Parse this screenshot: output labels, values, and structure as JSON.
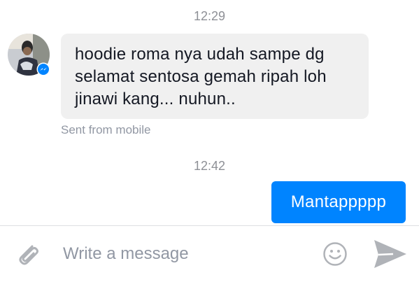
{
  "thread": {
    "timestamps": [
      "12:29",
      "12:42"
    ],
    "incoming": {
      "avatar_icon": "user-avatar-with-messenger-badge",
      "lines": [
        "hoodie roma nya udah sampe dg",
        "selamat sentosa gemah ripah loh",
        "jinawi kang... nuhun.."
      ],
      "footnote": "Sent from mobile",
      "bubble_color": "#f0f0f0"
    },
    "outgoing": {
      "text": "Mantappppp",
      "bubble_color": "#0084ff"
    }
  },
  "composer": {
    "placeholder": "Write a message",
    "value": "",
    "icons": {
      "attach": "paperclip-icon",
      "emoji": "smiley-icon",
      "send": "send-arrow-icon"
    }
  },
  "colors": {
    "accent": "#0084ff",
    "muted_text": "#9197a3",
    "icon_gray": "#b0b3b8"
  }
}
